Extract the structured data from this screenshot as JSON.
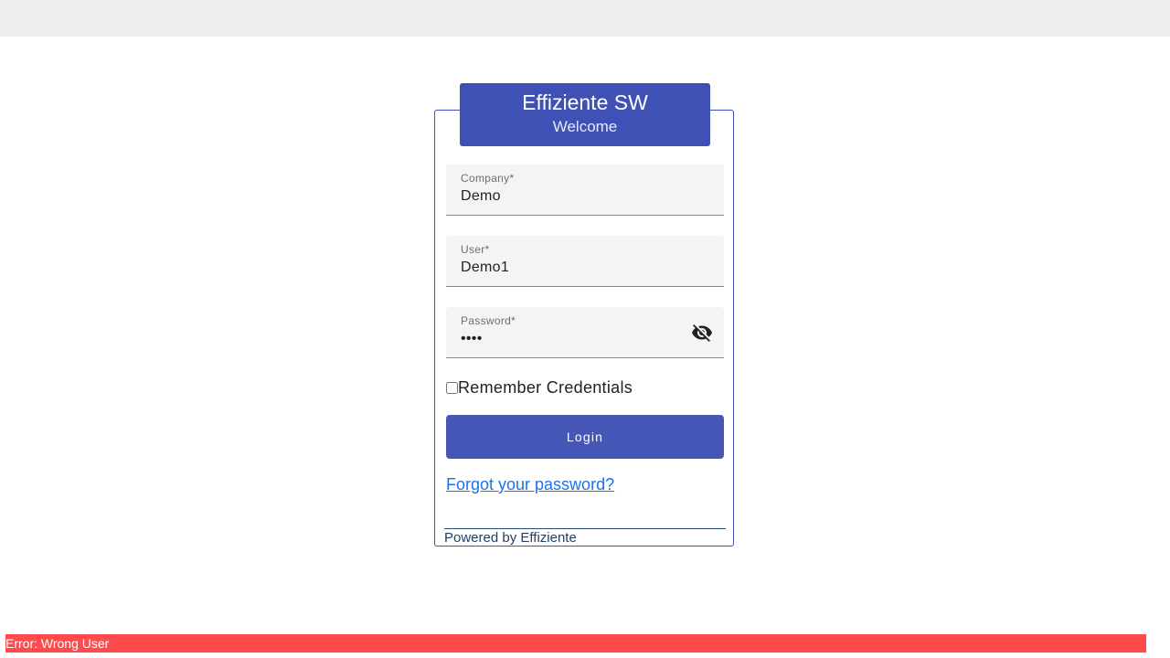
{
  "header": {
    "title": "Effiziente SW",
    "subtitle": "Welcome"
  },
  "form": {
    "company": {
      "label": "Company*",
      "value": "Demo"
    },
    "user": {
      "label": "User*",
      "value": "Demo1"
    },
    "password": {
      "label": "Password*",
      "value": "••••"
    },
    "remember_label": "Remember Credentials",
    "login_label": "Login",
    "forgot_label": "Forgot your password?"
  },
  "footer": {
    "powered_by": "Powered by Effiziente"
  },
  "error": {
    "message": "Error: Wrong User"
  },
  "colors": {
    "primary": "#3f51b5",
    "error": "#ff4b4e",
    "link": "#1a73e8"
  },
  "icons": {
    "password_toggle": "eye-off-icon"
  }
}
